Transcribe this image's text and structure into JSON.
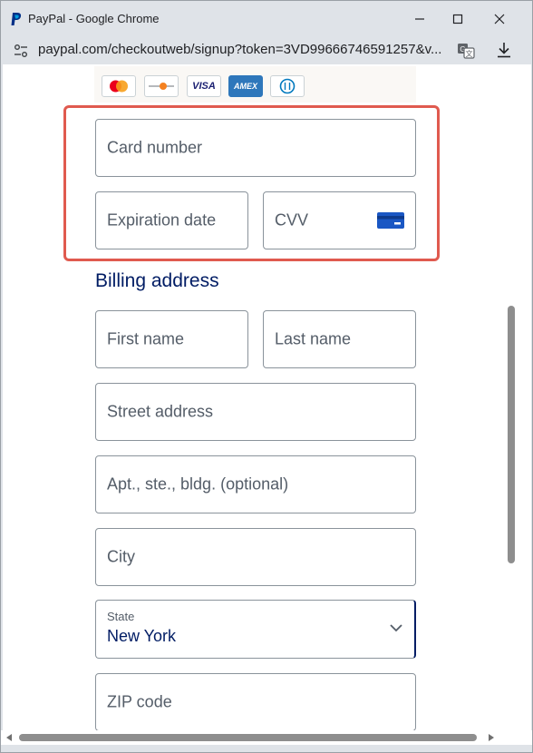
{
  "window": {
    "title": "PayPal - Google Chrome"
  },
  "addressbar": {
    "url": "paypal.com/checkoutweb/signup?token=3VD99666746591257&v..."
  },
  "card_logos": [
    {
      "name": "mastercard-logo"
    },
    {
      "name": "discover-logo"
    },
    {
      "name": "visa-logo",
      "text": "VISA"
    },
    {
      "name": "amex-logo",
      "text": "AMEX"
    },
    {
      "name": "diners-logo"
    }
  ],
  "card_form": {
    "card_number_placeholder": "Card number",
    "expiration_placeholder": "Expiration date",
    "cvv_placeholder": "CVV"
  },
  "billing": {
    "title": "Billing address",
    "first_name_placeholder": "First name",
    "last_name_placeholder": "Last name",
    "street_placeholder": "Street address",
    "apt_placeholder": "Apt., ste., bldg. (optional)",
    "city_placeholder": "City",
    "state_label": "State",
    "state_value": "New York",
    "zip_placeholder": "ZIP code"
  },
  "colors": {
    "highlight_border": "#e05a4f",
    "paypal_navy": "#001c64",
    "cvv_icon": "#1a57c4"
  }
}
